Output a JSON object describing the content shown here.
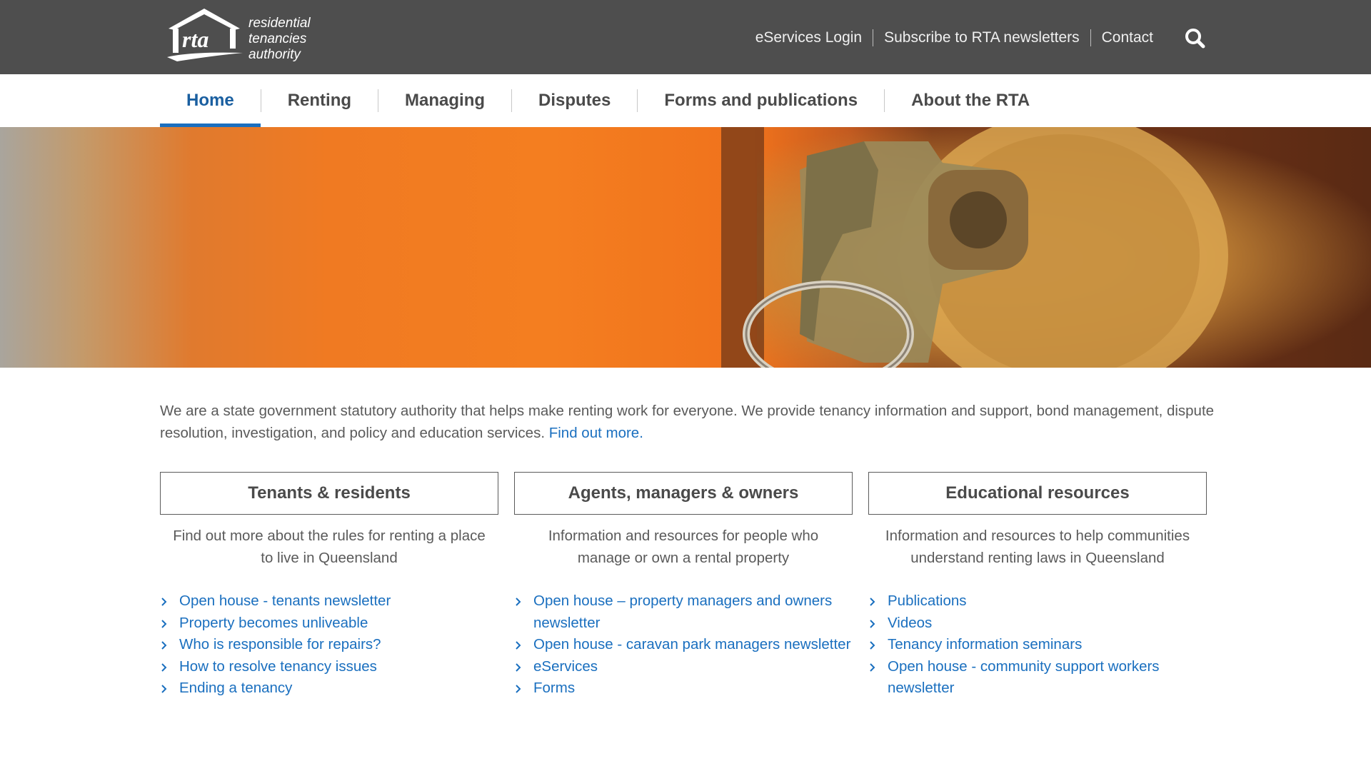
{
  "header": {
    "logo_mark": "rta",
    "logo_words": [
      "residential",
      "tenancies",
      "authority"
    ],
    "util_links": [
      "eServices Login",
      "Subscribe to RTA newsletters",
      "Contact"
    ],
    "search_icon": "search-icon"
  },
  "nav": {
    "items": [
      "Home",
      "Renting",
      "Managing",
      "Disputes",
      "Forms and publications",
      "About the RTA"
    ],
    "active": "Home"
  },
  "intro": {
    "text": "We are a state government statutory authority that helps make renting work for everyone. We provide tenancy information and support, bond management, dispute resolution, investigation, and policy and education services. ",
    "link": "Find out more",
    "link_suffix": "."
  },
  "columns": [
    {
      "title": "Tenants & residents",
      "description": "Find out more about the rules for renting a place to live in Queensland",
      "links": [
        "Open house - tenants newsletter",
        "Property becomes unliveable",
        "Who is responsible for repairs?",
        "How to resolve tenancy issues",
        "Ending a tenancy"
      ]
    },
    {
      "title": "Agents, managers & owners",
      "description": "Information and resources for people who manage or own a rental property",
      "links": [
        "Open house – property managers and owners newsletter",
        "Open house - caravan park managers newsletter",
        "eServices",
        "Forms"
      ]
    },
    {
      "title": "Educational resources",
      "description": "Information and resources to help communities understand renting laws in Queensland",
      "links": [
        "Publications",
        "Videos",
        "Tenancy information seminars",
        "Open house - community support workers newsletter"
      ]
    }
  ],
  "colors": {
    "topbar": "#4e4e4e",
    "accent": "#1a6fbf",
    "text": "#5a5a5a"
  }
}
